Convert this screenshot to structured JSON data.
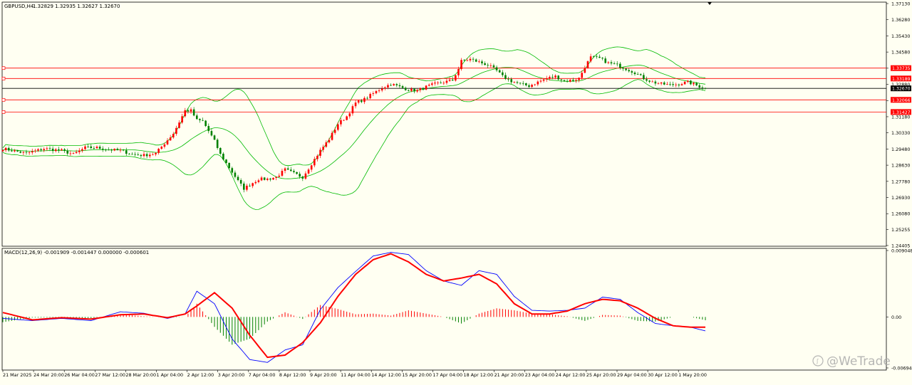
{
  "chart_data": [
    {
      "type": "candlestick",
      "panel": "price",
      "title": "GBPUSD,H4",
      "ohlc_header": "1.32829 1.32935 1.32627 1.32670",
      "ylim": [
        1.24405,
        1.3713
      ],
      "y_ticks": [
        1.3713,
        1.3628,
        1.3543,
        1.3458,
        1.3373,
        1.3288,
        1.3203,
        1.3118,
        1.3033,
        1.2948,
        1.2863,
        1.2778,
        1.2693,
        1.2608,
        1.2525,
        1.24405
      ],
      "y_tick_labels": [
        "1.37130",
        "1.36280",
        "1.35430",
        "1.34580",
        "1.33730",
        "1.32880",
        "1.32030",
        "1.31180",
        "1.30330",
        "1.29480",
        "1.28630",
        "1.27780",
        "1.26930",
        "1.26080",
        "1.25255",
        "1.24405"
      ],
      "current_price": 1.3267,
      "current_price_label": "1.32670",
      "horizontal_levels": [
        {
          "value": 1.33735,
          "label": "1.33735",
          "color": "#ff0000"
        },
        {
          "value": 1.33189,
          "label": "1.33189",
          "color": "#ff0000"
        },
        {
          "value": 1.32066,
          "label": "1.32066",
          "color": "#ff0000"
        },
        {
          "value": 1.31427,
          "label": "1.31427",
          "color": "#ff0000"
        }
      ],
      "overlay": "Bollinger Bands",
      "colors": {
        "bull": "#ff0000",
        "bear": "#008000",
        "bands": "#00bb00",
        "level": "#ff0000",
        "current": "#000000"
      },
      "close_key_points": [
        [
          0,
          1.295
        ],
        [
          8,
          1.2925
        ],
        [
          14,
          1.295
        ],
        [
          20,
          1.294
        ],
        [
          24,
          1.292
        ],
        [
          28,
          1.2955
        ],
        [
          32,
          1.2955
        ],
        [
          36,
          1.2945
        ],
        [
          40,
          1.294
        ],
        [
          44,
          1.292
        ],
        [
          48,
          1.2915
        ],
        [
          52,
          1.2925
        ],
        [
          54,
          1.296
        ],
        [
          58,
          1.303
        ],
        [
          62,
          1.315
        ],
        [
          64,
          1.315
        ],
        [
          66,
          1.31
        ],
        [
          68,
          1.3095
        ],
        [
          72,
          1.299
        ],
        [
          74,
          1.292
        ],
        [
          77,
          1.285
        ],
        [
          80,
          1.278
        ],
        [
          82,
          1.274
        ],
        [
          84,
          1.276
        ],
        [
          87,
          1.279
        ],
        [
          90,
          1.279
        ],
        [
          93,
          1.28
        ],
        [
          96,
          1.284
        ],
        [
          99,
          1.282
        ],
        [
          102,
          1.28
        ],
        [
          105,
          1.287
        ],
        [
          108,
          1.294
        ],
        [
          111,
          1.3
        ],
        [
          114,
          1.308
        ],
        [
          117,
          1.312
        ],
        [
          120,
          1.319
        ],
        [
          123,
          1.321
        ],
        [
          126,
          1.324
        ],
        [
          129,
          1.327
        ],
        [
          132,
          1.329
        ],
        [
          135,
          1.3275
        ],
        [
          138,
          1.326
        ],
        [
          141,
          1.3255
        ],
        [
          144,
          1.3275
        ],
        [
          147,
          1.329
        ],
        [
          150,
          1.33
        ],
        [
          153,
          1.331
        ],
        [
          155,
          1.337
        ],
        [
          156,
          1.341
        ],
        [
          159,
          1.342
        ],
        [
          162,
          1.3405
        ],
        [
          165,
          1.339
        ],
        [
          168,
          1.336
        ],
        [
          170,
          1.333
        ],
        [
          173,
          1.3305
        ],
        [
          176,
          1.329
        ],
        [
          179,
          1.328
        ],
        [
          182,
          1.33
        ],
        [
          185,
          1.332
        ],
        [
          188,
          1.333
        ],
        [
          191,
          1.3305
        ],
        [
          194,
          1.331
        ],
        [
          196,
          1.332
        ],
        [
          198,
          1.338
        ],
        [
          200,
          1.343
        ],
        [
          203,
          1.3425
        ],
        [
          206,
          1.34
        ],
        [
          209,
          1.339
        ],
        [
          212,
          1.337
        ],
        [
          215,
          1.335
        ],
        [
          218,
          1.332
        ],
        [
          221,
          1.33
        ],
        [
          224,
          1.329
        ],
        [
          227,
          1.3285
        ],
        [
          230,
          1.329
        ],
        [
          233,
          1.33
        ],
        [
          236,
          1.3283
        ],
        [
          239,
          1.3267
        ]
      ],
      "x_tick_labels": [
        "21 Mar 2025",
        "24 Mar 20:00",
        "26 Mar 04:00",
        "27 Mar 12:00",
        "28 Mar 20:00",
        "1 Apr 04:00",
        "2 Apr 12:00",
        "3 Apr 20:00",
        "7 Apr 04:00",
        "8 Apr 12:00",
        "9 Apr 20:00",
        "11 Apr 04:00",
        "14 Apr 12:00",
        "15 Apr 20:00",
        "17 Apr 04:00",
        "18 Apr 12:00",
        "21 Apr 20:00",
        "23 Apr 04:00",
        "24 Apr 12:00",
        "25 Apr 20:00",
        "29 Apr 04:00",
        "30 Apr 12:00",
        "1 May 20:00"
      ]
    },
    {
      "type": "macd",
      "panel": "indicator",
      "title": "MACD(12,26,9) -0.001909 -0.001447 0.000000 -0.000601",
      "ylim": [
        -0.006946,
        0.009048
      ],
      "y_tick_labels": [
        "0.009048",
        "0.00",
        "-0.006946"
      ],
      "y_tick_values": [
        0.009048,
        0.0,
        -0.006946
      ],
      "colors": {
        "histogram_positive": "#ff0000",
        "histogram_negative": "#008000",
        "main": "#0000ff",
        "signal": "#ff0000"
      },
      "main_key_points": [
        [
          0,
          -0.0002
        ],
        [
          10,
          -0.0005
        ],
        [
          20,
          -0.0002
        ],
        [
          30,
          -0.0005
        ],
        [
          40,
          0.0007
        ],
        [
          48,
          0.0005
        ],
        [
          56,
          -0.0002
        ],
        [
          62,
          0.0004
        ],
        [
          66,
          0.0035
        ],
        [
          72,
          0.0018
        ],
        [
          78,
          -0.003
        ],
        [
          84,
          -0.0058
        ],
        [
          90,
          -0.0062
        ],
        [
          96,
          -0.0045
        ],
        [
          102,
          -0.0038
        ],
        [
          108,
          0.001
        ],
        [
          114,
          0.004
        ],
        [
          120,
          0.0062
        ],
        [
          126,
          0.0083
        ],
        [
          132,
          0.0088
        ],
        [
          138,
          0.0085
        ],
        [
          144,
          0.0063
        ],
        [
          150,
          0.0049
        ],
        [
          156,
          0.0043
        ],
        [
          162,
          0.0063
        ],
        [
          168,
          0.0058
        ],
        [
          174,
          0.0028
        ],
        [
          180,
          0.0009
        ],
        [
          186,
          0.0008
        ],
        [
          192,
          0.0009
        ],
        [
          198,
          0.0012
        ],
        [
          204,
          0.0027
        ],
        [
          210,
          0.0024
        ],
        [
          216,
          0.0006
        ],
        [
          222,
          -0.0009
        ],
        [
          228,
          -0.0012
        ],
        [
          234,
          -0.0014
        ],
        [
          239,
          -0.0019
        ]
      ],
      "signal_key_points": [
        [
          0,
          0.0006
        ],
        [
          10,
          -0.0004
        ],
        [
          20,
          -0.0001
        ],
        [
          30,
          -0.0003
        ],
        [
          40,
          0.0003
        ],
        [
          48,
          0.0004
        ],
        [
          56,
          -0.0001
        ],
        [
          62,
          0.0004
        ],
        [
          66,
          0.0015
        ],
        [
          72,
          0.0033
        ],
        [
          78,
          0.0012
        ],
        [
          84,
          -0.0025
        ],
        [
          90,
          -0.0055
        ],
        [
          96,
          -0.0052
        ],
        [
          102,
          -0.0035
        ],
        [
          108,
          -0.0008
        ],
        [
          114,
          0.0028
        ],
        [
          120,
          0.0058
        ],
        [
          126,
          0.0078
        ],
        [
          132,
          0.0086
        ],
        [
          138,
          0.0075
        ],
        [
          144,
          0.0058
        ],
        [
          150,
          0.0049
        ],
        [
          156,
          0.0053
        ],
        [
          162,
          0.0058
        ],
        [
          168,
          0.0045
        ],
        [
          174,
          0.0018
        ],
        [
          180,
          0.0004
        ],
        [
          186,
          0.0004
        ],
        [
          192,
          0.0008
        ],
        [
          198,
          0.0018
        ],
        [
          204,
          0.0024
        ],
        [
          210,
          0.0022
        ],
        [
          216,
          0.0012
        ],
        [
          222,
          -0.0002
        ],
        [
          228,
          -0.0012
        ],
        [
          234,
          -0.0014
        ],
        [
          239,
          -0.0014
        ]
      ]
    }
  ],
  "watermark": {
    "text": "@WeTrade"
  }
}
